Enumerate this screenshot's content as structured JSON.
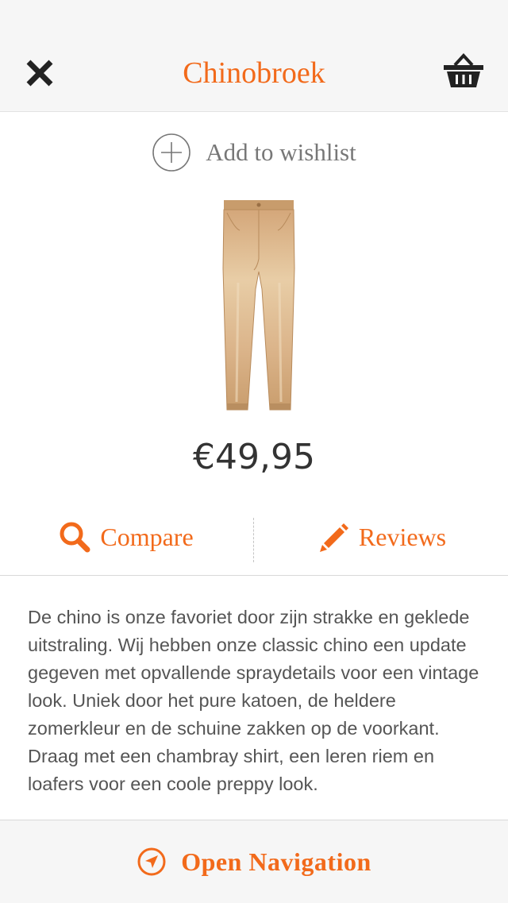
{
  "header": {
    "title": "Chinobroek",
    "close_icon": "close-icon",
    "basket_icon": "basket-icon"
  },
  "wishlist": {
    "label": "Add to wishlist",
    "icon": "plus-circle-icon"
  },
  "product": {
    "image": "chino-pants",
    "price": "€49,95"
  },
  "actions": {
    "compare_label": "Compare",
    "compare_icon": "search-icon",
    "reviews_label": "Reviews",
    "reviews_icon": "pencil-icon"
  },
  "description": "De chino is onze favoriet door zijn strakke en geklede uitstraling. Wij hebben onze classic chino een update gegeven met opvallende spraydetails voor een vintage look. Uniek door het pure katoen, de heldere zomerkleur en de schuine zakken op de voorkant. Draag met een chambray shirt, een leren riem en loafers voor een coole preppy look.",
  "footer": {
    "label": "Open Navigation",
    "icon": "navigation-arrow-icon"
  },
  "colors": {
    "accent": "#f26a1b",
    "header_bg": "#f6f6f6",
    "text": "#333333",
    "body_text": "#555555"
  }
}
